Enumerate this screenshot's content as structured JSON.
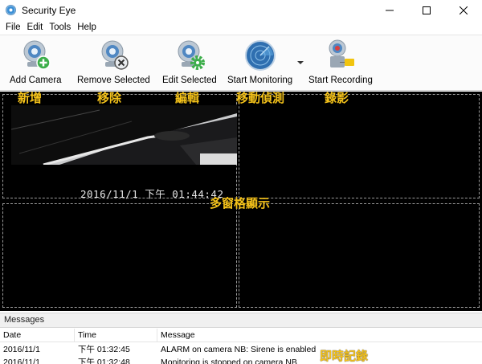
{
  "window": {
    "title": "Security Eye"
  },
  "menu": [
    "File",
    "Edit",
    "Tools",
    "Help"
  ],
  "toolbar": {
    "add_camera": "Add Camera",
    "remove_selected": "Remove Selected",
    "edit_selected": "Edit Selected",
    "start_monitoring": "Start Monitoring",
    "start_recording": "Start Recording"
  },
  "annotations": {
    "add": "新增",
    "remove": "移除",
    "edit": "編輯",
    "motion": "移動偵測",
    "record": "錄影",
    "multi_grid": "多窗格顯示",
    "realtime_log": "即時記錄"
  },
  "camera": {
    "timestamp": "2016/11/1  下午  01:44:42"
  },
  "messages": {
    "title": "Messages",
    "columns": [
      "Date",
      "Time",
      "Message"
    ],
    "rows": [
      {
        "date": "2016/11/1",
        "time": "下午 01:32:45",
        "message": "ALARM on camera NB: Sirene is enabled"
      },
      {
        "date": "2016/11/1",
        "time": "下午 01:32:48",
        "message": "Monitoring is stopped on camera NB"
      }
    ]
  },
  "colors": {
    "accent_green": "#3cae4a",
    "annotation_yellow": "#f4c21a",
    "camera_bg": "#000000"
  }
}
